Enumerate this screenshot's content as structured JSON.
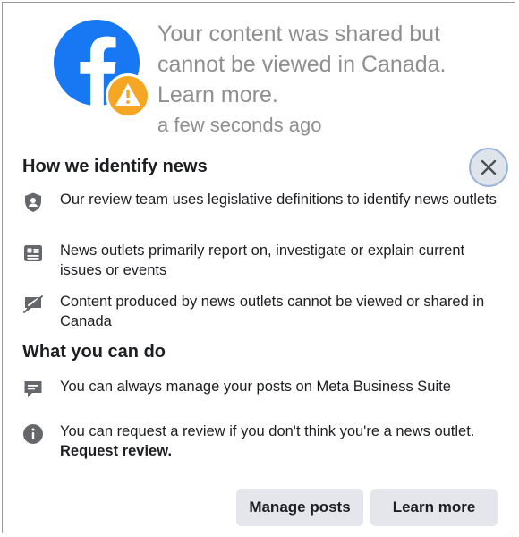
{
  "notification": {
    "message": "Your content was shared but cannot be viewed in Canada. Learn more.",
    "time": "a few seconds ago"
  },
  "section_identify": {
    "title": "How we identify news",
    "items": [
      {
        "icon": "shield-person-icon",
        "text": "Our review team uses legislative definitions to identify news outlets"
      },
      {
        "icon": "newspaper-icon",
        "text": "News outlets primarily report on, investigate or explain current issues or events"
      },
      {
        "icon": "chat-blocked-icon",
        "text": "Content produced by news outlets cannot be viewed or shared in Canada"
      }
    ]
  },
  "section_actions": {
    "title": "What you can do",
    "items": [
      {
        "icon": "message-icon",
        "text": "You can always manage your posts on Meta Business Suite"
      },
      {
        "icon": "info-icon",
        "text": "You can request a review if you don't think you're a news outlet.",
        "link": "Request review."
      }
    ]
  },
  "buttons": {
    "manage_posts": "Manage posts",
    "learn_more": "Learn more"
  },
  "colors": {
    "facebook_blue": "#1877f2",
    "warning_orange": "#f5a623",
    "button_gray": "#e4e6eb"
  }
}
